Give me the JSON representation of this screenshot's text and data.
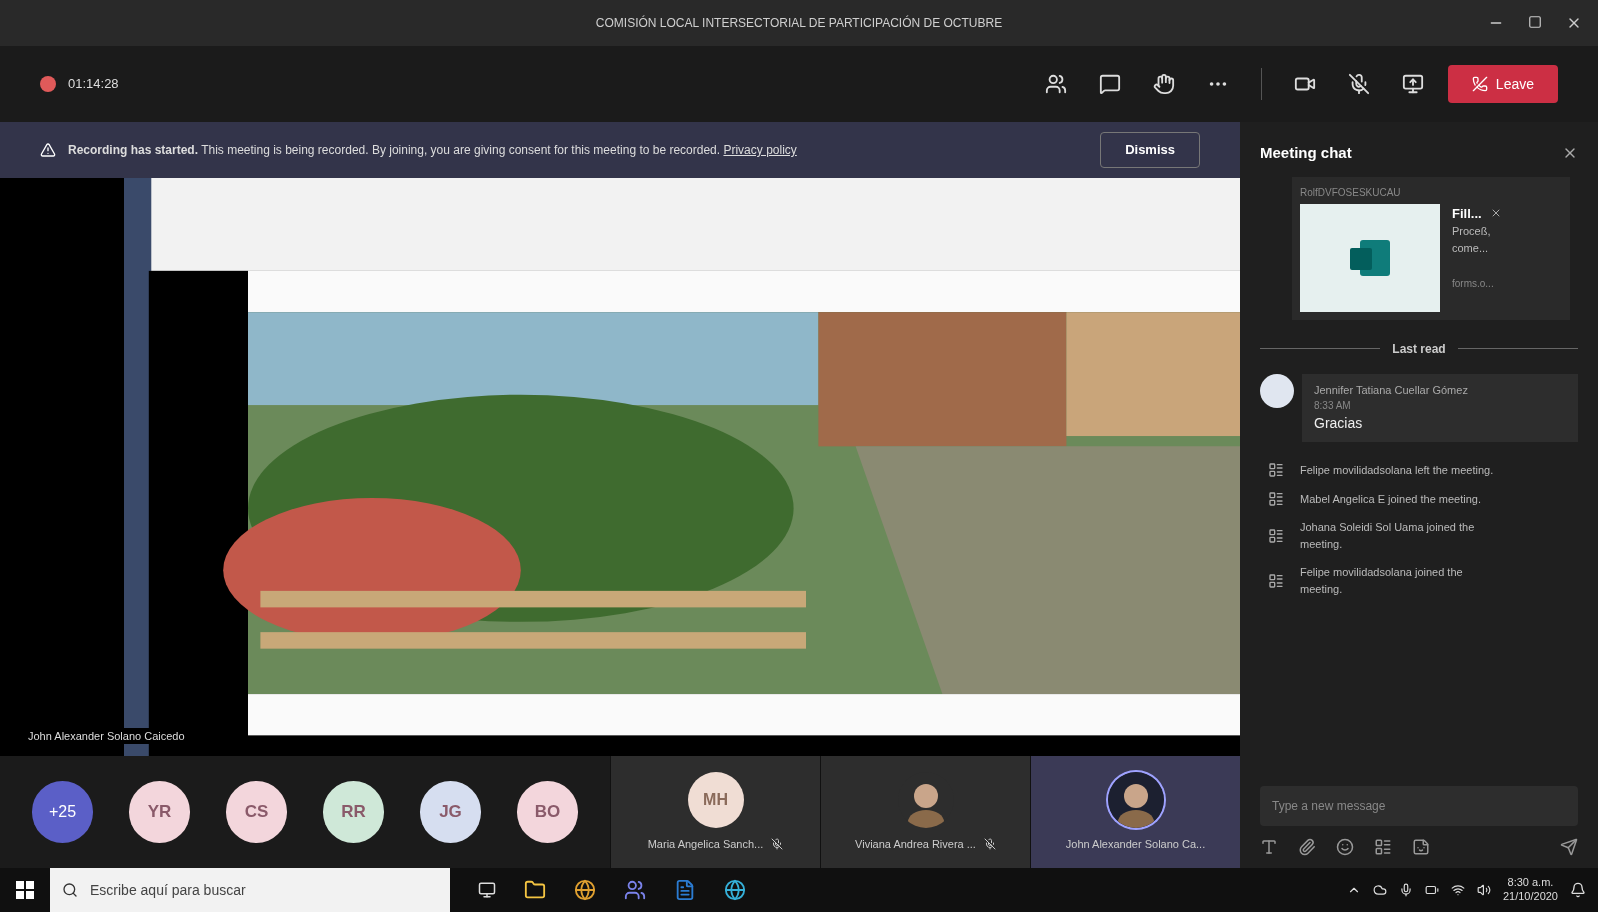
{
  "window": {
    "title": "COMISIÓN LOCAL INTERSECTORIAL DE PARTICIPACIÓN DE OCTUBRE"
  },
  "toolbar": {
    "recording": true,
    "timer": "01:14:28",
    "leave": "Leave"
  },
  "banner": {
    "text": "**Recording has started.** This meeting is being recorded. By joining, you are giving consent for this meeting to be recorded.",
    "link": "Privacy policy",
    "button": "Dismiss"
  },
  "stage": {
    "presenter": "John Alexander Solano Caicedo"
  },
  "participants": {
    "overflow": "+25",
    "avatars": [
      {
        "initials": "YR",
        "color": "#f3d6dc"
      },
      {
        "initials": "CS",
        "color": "#f3d6dc"
      },
      {
        "initials": "RR",
        "color": "#cfe8d8"
      },
      {
        "initials": "JG",
        "color": "#d6def0"
      },
      {
        "initials": "BO",
        "color": "#f3d6dc"
      }
    ],
    "tiles": [
      {
        "kind": "initials",
        "initials": "MH",
        "name": "Maria Angelica Sanch...",
        "muted": true,
        "speaking": false
      },
      {
        "name": "Viviana Andrea Rivera ...",
        "muted": true,
        "speaking": false
      },
      {
        "name": "John Alexander Solano Ca...",
        "muted": false,
        "speaking": true
      }
    ]
  },
  "chat": {
    "title": "Meeting chat",
    "card": {
      "header": "RolfDVFOSESKUCAU",
      "title": "Fill...",
      "lines": [
        "Proceß,",
        "come..."
      ],
      "footer": "forms.o..."
    },
    "divider": "Last read",
    "message": {
      "author": "Jennifer Tatiana Cuellar Gómez",
      "time": "8:33 AM",
      "text": "Gracias"
    },
    "events": [
      "Felipe movilidadsolana left the meeting.",
      "Mabel Angelica E joined the meeting.",
      "Johana Soleidi Sol Uama joined the meeting.",
      "Felipe movilidadsolana joined the meeting."
    ],
    "compose": {
      "placeholder": "Type a new message"
    }
  },
  "taskbar": {
    "search": {
      "placeholder": "Escribe aquí para buscar"
    },
    "time": "8:30 a.m.",
    "date": "21/10/2020"
  }
}
